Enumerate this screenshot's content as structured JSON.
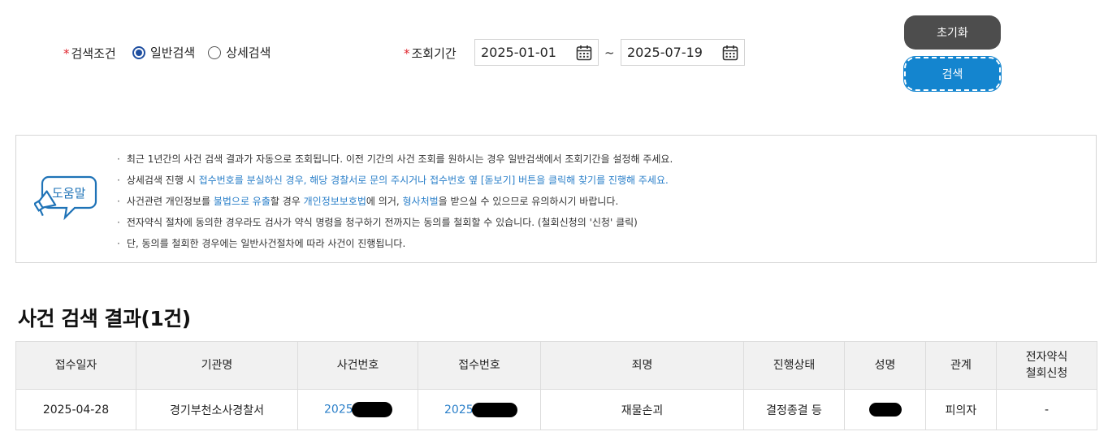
{
  "search": {
    "condition_label": "검색조건",
    "condition_options": [
      {
        "label": "일반검색",
        "checked": true
      },
      {
        "label": "상세검색",
        "checked": false
      }
    ],
    "period_label": "조회기간",
    "date_from": "2025-01-01",
    "date_to": "2025-07-19",
    "separator": "~",
    "required_mark": "*",
    "reset_button": "초기화",
    "search_button": "검색"
  },
  "help": {
    "icon_label": "도움말",
    "lines": [
      [
        {
          "t": "최근 1년간의 사건 검색 결과가 자동으로 조회됩니다. 이전 기간의 사건 조회를 원하시는 경우 일반검색에서 조회기간을 설정해 주세요."
        }
      ],
      [
        {
          "t": "상세검색 진행 시 "
        },
        {
          "t": "접수번호를 분실하신 경우, 해당 경찰서로 문의 주시거나 접수번호 옆 [돋보기] 버튼을 클릭해 찾기를 진행해 주세요.",
          "blue": true
        }
      ],
      [
        {
          "t": "사건관련 개인정보를 "
        },
        {
          "t": "불법으로 유출",
          "blue": true
        },
        {
          "t": "할 경우 "
        },
        {
          "t": "개인정보보호법",
          "blue": true
        },
        {
          "t": "에 의거, "
        },
        {
          "t": "형사처벌",
          "blue": true
        },
        {
          "t": "을 받으실 수 있으므로 유의하시기 바랍니다."
        }
      ],
      [
        {
          "t": "전자약식 절차에 동의한 경우라도 검사가 약식 명령을 청구하기 전까지는 동의를 철회할 수 있습니다. (철회신청의 '신청' 클릭)"
        }
      ],
      [
        {
          "t": "단, 동의를 철회한 경우에는 일반사건절차에 따라 사건이 진행됩니다."
        }
      ]
    ]
  },
  "result": {
    "title": "사건 검색 결과(1건)",
    "columns": [
      "접수일자",
      "기관명",
      "사건번호",
      "접수번호",
      "죄명",
      "진행상태",
      "성명",
      "관계",
      "전자약식\n철회신청"
    ],
    "rows": [
      {
        "date": "2025-04-28",
        "agency": "경기부천소사경찰서",
        "case_no": "2025",
        "receipt_no": "2025",
        "offense": "재물손괴",
        "status": "결정종결 등",
        "name": "",
        "relation": "피의자",
        "withdraw": "-"
      }
    ]
  },
  "colors": {
    "required": "#e0242c",
    "link": "#2a7fc9",
    "search_button": "#1485cf",
    "reset_button": "#4d4d4d",
    "header_bg": "#f1f1f1"
  }
}
